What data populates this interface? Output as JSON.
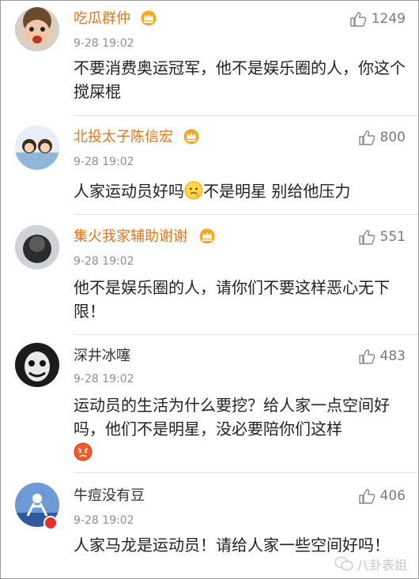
{
  "comments": [
    {
      "username": "吃瓜群仲",
      "time": "9-28 19:02",
      "likes": "1249",
      "text": "不要消费奥运冠军，他不是娱乐圈的人，你这个搅屎棍"
    },
    {
      "username": "北投太子陈信宏",
      "time": "9-28 19:02",
      "likes": "800",
      "text_before_emoji": "人家运动员好吗",
      "text_after_emoji": "不是明星 别给他压力"
    },
    {
      "username": "集火我家辅助谢谢",
      "time": "9-28 19:02",
      "likes": "551",
      "text": "他不是娱乐圈的人，请你们不要这样恶心无下限！"
    },
    {
      "username": "深井冰噻",
      "time": "9-28 19:02",
      "likes": "483",
      "text": "运动员的生活为什么要挖？给人家一点空间好吗，他们不是明星，没必要陪你们这样"
    },
    {
      "username": "牛痘没有豆",
      "time": "9-28 19:02",
      "likes": "406",
      "text": "人家马龙是运动员！请给人家一些空间好吗！"
    }
  ],
  "watermark": {
    "text": "八卦表姐"
  },
  "colors": {
    "vip_name": "#e5751b",
    "plain_name": "#333333",
    "time": "#8f8f8f",
    "like": "#7a7a7a"
  }
}
